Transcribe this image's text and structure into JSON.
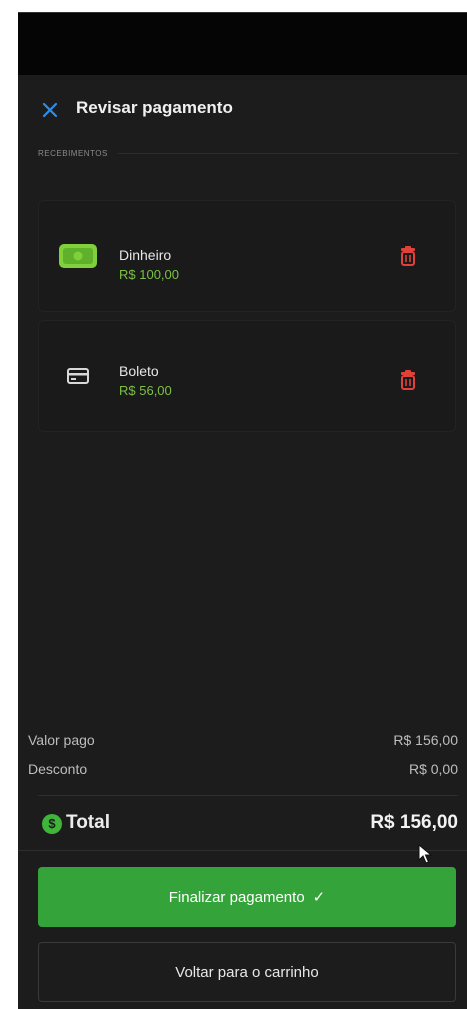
{
  "header": {
    "title": "Revisar pagamento",
    "close_icon": "close-icon"
  },
  "section": {
    "label": "RECEBIMENTOS"
  },
  "payments": [
    {
      "name": "Dinheiro",
      "amount": "R$ 100,00",
      "icon": "cash-icon"
    },
    {
      "name": "Boleto",
      "amount": "R$ 56,00",
      "icon": "card-icon"
    }
  ],
  "summary": {
    "paid_label": "Valor pago",
    "paid_value": "R$ 156,00",
    "discount_label": "Desconto",
    "discount_value": "R$ 0,00",
    "total_label": "Total",
    "total_value": "R$ 156,00",
    "total_icon_glyph": "$"
  },
  "actions": {
    "finalize_label": "Finalizar pagamento",
    "finalize_check": "✓",
    "back_label": "Voltar para o carrinho"
  },
  "colors": {
    "accent_blue": "#2a8ff0",
    "success_green": "#34a43a",
    "amount_green": "#7bc043",
    "danger_red": "#e0413a",
    "background": "#1c1c1c"
  }
}
